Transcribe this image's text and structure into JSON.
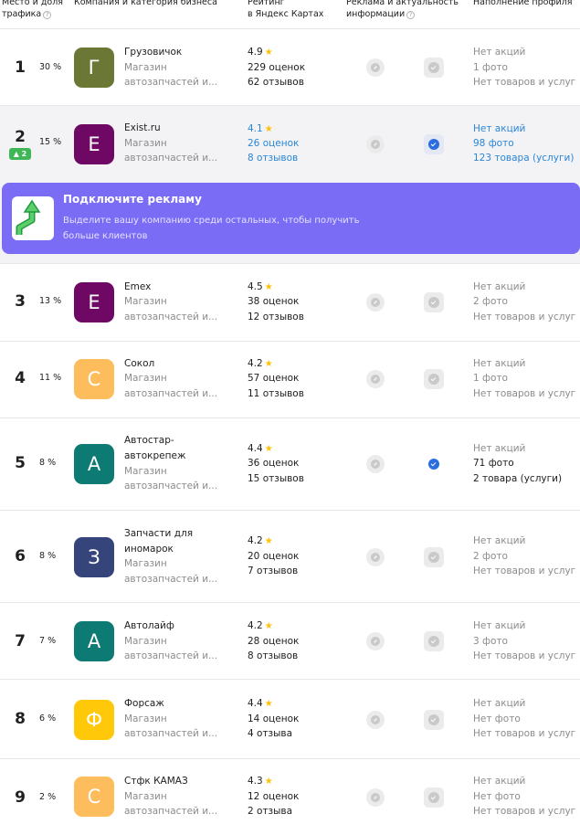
{
  "header": {
    "col_place": "Место и доля трафика",
    "col_company": "Компания и категория бизнеса",
    "col_rating_1": "Рейтинг",
    "col_rating_2": "в Яндекс Картах",
    "col_ads": "Реклама и актуальность информации",
    "col_profile": "Наполнение профиля",
    "help_glyph": "?"
  },
  "promo": {
    "title": "Подключите рекламу",
    "description": "Выделите вашу компанию среди остальных, чтобы получить больше клиентов"
  },
  "star_glyph": "★",
  "rows": [
    {
      "place": "1",
      "share": "30 %",
      "letter": "Г",
      "avatar_color": "#6a7735",
      "name": "Грузовичок",
      "cat1": "Магазин",
      "cat2": "автозапчастей и...",
      "rating": "4.9",
      "reviews_count": "229 оценок",
      "reviews_text": "62 отзывов",
      "promos": "Нет акций",
      "photos": "1 фото",
      "goods": "Нет товаров и услуг",
      "actuality_confirmed": false
    },
    {
      "place": "2",
      "share": "15 %",
      "badge": "▲ 2",
      "letter": "E",
      "avatar_color": "#6e0864",
      "name": "Exist.ru",
      "cat1": "Магазин",
      "cat2": "автозапчастей и...",
      "rating": "4.1",
      "reviews_count": "26 оценок",
      "reviews_text": "8 отзывов",
      "promos": "Нет акций",
      "photos": "98 фото",
      "goods": "123 товара (услуги)",
      "actuality_confirmed": true,
      "highlight": true
    },
    {
      "place": "3",
      "share": "13 %",
      "letter": "E",
      "avatar_color": "#6e0864",
      "name": "Emex",
      "cat1": "Магазин",
      "cat2": "автозапчастей и...",
      "rating": "4.5",
      "reviews_count": "38 оценок",
      "reviews_text": "12 отзывов",
      "promos": "Нет акций",
      "photos": "2 фото",
      "goods": "Нет товаров и услуг",
      "actuality_confirmed": false
    },
    {
      "place": "4",
      "share": "11 %",
      "letter": "С",
      "avatar_color": "#fdbd5c",
      "name": "Сокол",
      "cat1": "Магазин",
      "cat2": "автозапчастей и...",
      "rating": "4.2",
      "reviews_count": "57 оценок",
      "reviews_text": "11 отзывов",
      "promos": "Нет акций",
      "photos": "1 фото",
      "goods": "Нет товаров и услуг",
      "actuality_confirmed": false
    },
    {
      "place": "5",
      "share": "8 %",
      "letter": "А",
      "avatar_color": "#0d7b74",
      "name1": "Автостар-",
      "name2": "автокрепеж",
      "cat1": "Магазин",
      "cat2": "автозапчастей и...",
      "rating": "4.4",
      "reviews_count": "36 оценок",
      "reviews_text": "15 отзывов",
      "promos": "Нет акций",
      "photos": "71 фото",
      "goods": "2 товара (услуги)",
      "actuality_confirmed": true
    },
    {
      "place": "6",
      "share": "8 %",
      "letter": "З",
      "avatar_color": "#36447c",
      "name1": "Запчасти для",
      "name2": "иномарок",
      "cat1": "Магазин",
      "cat2": "автозапчастей и...",
      "rating": "4.2",
      "reviews_count": "20 оценок",
      "reviews_text": "7 отзывов",
      "promos": "Нет акций",
      "photos": "2 фото",
      "goods": "Нет товаров и услуг",
      "actuality_confirmed": false
    },
    {
      "place": "7",
      "share": "7 %",
      "letter": "А",
      "avatar_color": "#0d7b74",
      "name": "Автолайф",
      "cat1": "Магазин",
      "cat2": "автозапчастей и...",
      "rating": "4.2",
      "reviews_count": "28 оценок",
      "reviews_text": "8 отзывов",
      "promos": "Нет акций",
      "photos": "3 фото",
      "goods": "Нет товаров и услуг",
      "actuality_confirmed": false
    },
    {
      "place": "8",
      "share": "6 %",
      "letter": "Ф",
      "avatar_color": "#ffc808",
      "name": "Форсаж",
      "cat1": "Магазин",
      "cat2": "автозапчастей и...",
      "rating": "4.4",
      "reviews_count": "14 оценок",
      "reviews_text": "4 отзыва",
      "promos": "Нет акций",
      "photos": "Нет фото",
      "goods": "Нет товаров и услуг",
      "actuality_confirmed": false
    },
    {
      "place": "9",
      "share": "2 %",
      "letter": "С",
      "avatar_color": "#fdbd5c",
      "name": "Стфк КАМАЗ",
      "cat1": "Магазин",
      "cat2": "автозапчастей и...",
      "rating": "4.3",
      "reviews_count": "12 оценок",
      "reviews_text": "2 отзыва",
      "promos": "Нет акций",
      "photos": "Нет фото",
      "goods": "Нет товаров и услуг",
      "actuality_confirmed": false
    }
  ]
}
